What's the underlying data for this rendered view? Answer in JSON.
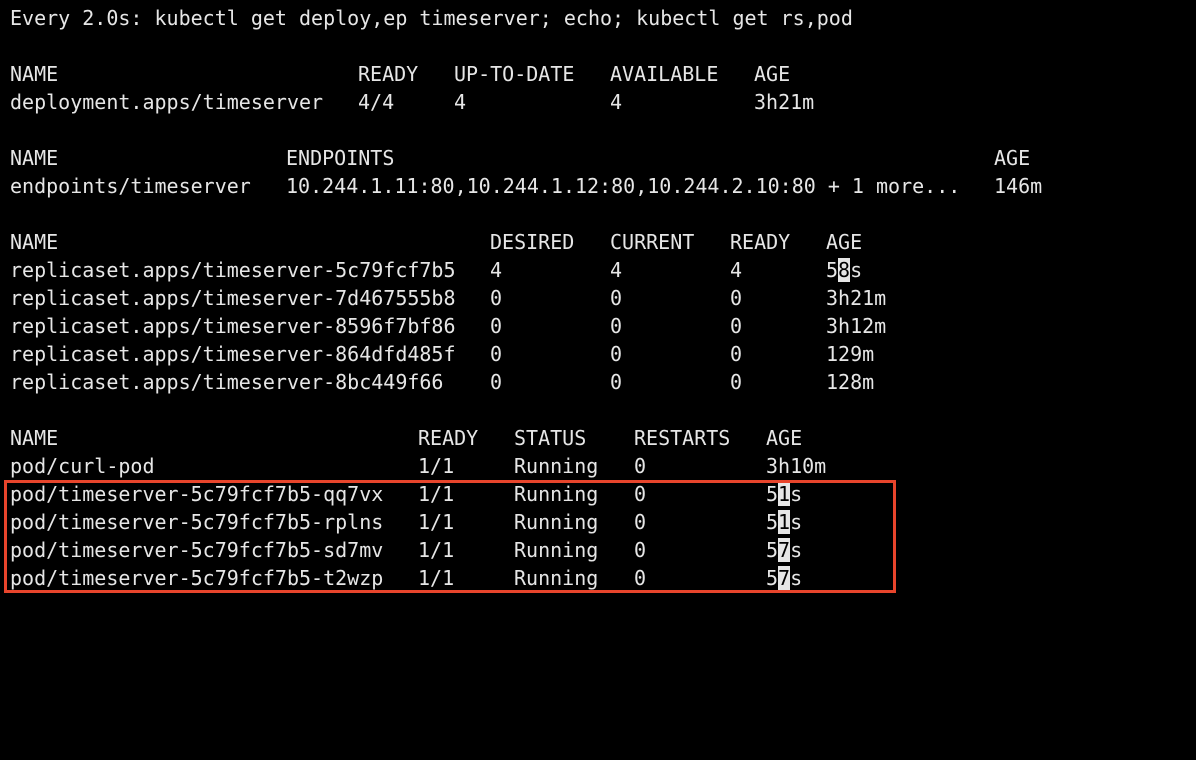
{
  "watch_header": "Every 2.0s: kubectl get deploy,ep timeserver; echo; kubectl get rs,pod",
  "deployment": {
    "headers": [
      "NAME",
      "READY",
      "UP-TO-DATE",
      "AVAILABLE",
      "AGE"
    ],
    "rows": [
      [
        "deployment.apps/timeserver",
        "4/4",
        "4",
        "4",
        "3h21m"
      ]
    ]
  },
  "endpoints": {
    "headers": [
      "NAME",
      "ENDPOINTS",
      "AGE"
    ],
    "rows": [
      [
        "endpoints/timeserver",
        "10.244.1.11:80,10.244.1.12:80,10.244.2.10:80 + 1 more...",
        "146m"
      ]
    ]
  },
  "replicasets": {
    "headers": [
      "NAME",
      "DESIRED",
      "CURRENT",
      "READY",
      "AGE"
    ],
    "rows": [
      [
        "replicaset.apps/timeserver-5c79fcf7b5",
        "4",
        "4",
        "4",
        "58s"
      ],
      [
        "replicaset.apps/timeserver-7d467555b8",
        "0",
        "0",
        "0",
        "3h21m"
      ],
      [
        "replicaset.apps/timeserver-8596f7bf86",
        "0",
        "0",
        "0",
        "3h12m"
      ],
      [
        "replicaset.apps/timeserver-864dfd485f",
        "0",
        "0",
        "0",
        "129m"
      ],
      [
        "replicaset.apps/timeserver-8bc449f66",
        "0",
        "0",
        "0",
        "128m"
      ]
    ]
  },
  "pods": {
    "headers": [
      "NAME",
      "READY",
      "STATUS",
      "RESTARTS",
      "AGE"
    ],
    "rows": [
      [
        "pod/curl-pod",
        "1/1",
        "Running",
        "0",
        "3h10m"
      ],
      [
        "pod/timeserver-5c79fcf7b5-qq7vx",
        "1/1",
        "Running",
        "0",
        "51s"
      ],
      [
        "pod/timeserver-5c79fcf7b5-rplns",
        "1/1",
        "Running",
        "0",
        "51s"
      ],
      [
        "pod/timeserver-5c79fcf7b5-sd7mv",
        "1/1",
        "Running",
        "0",
        "57s"
      ],
      [
        "pod/timeserver-5c79fcf7b5-t2wzp",
        "1/1",
        "Running",
        "0",
        "57s"
      ]
    ]
  },
  "colors": {
    "background": "#000000",
    "text": "#e6e6e6",
    "selection_box": "#e8452c"
  }
}
